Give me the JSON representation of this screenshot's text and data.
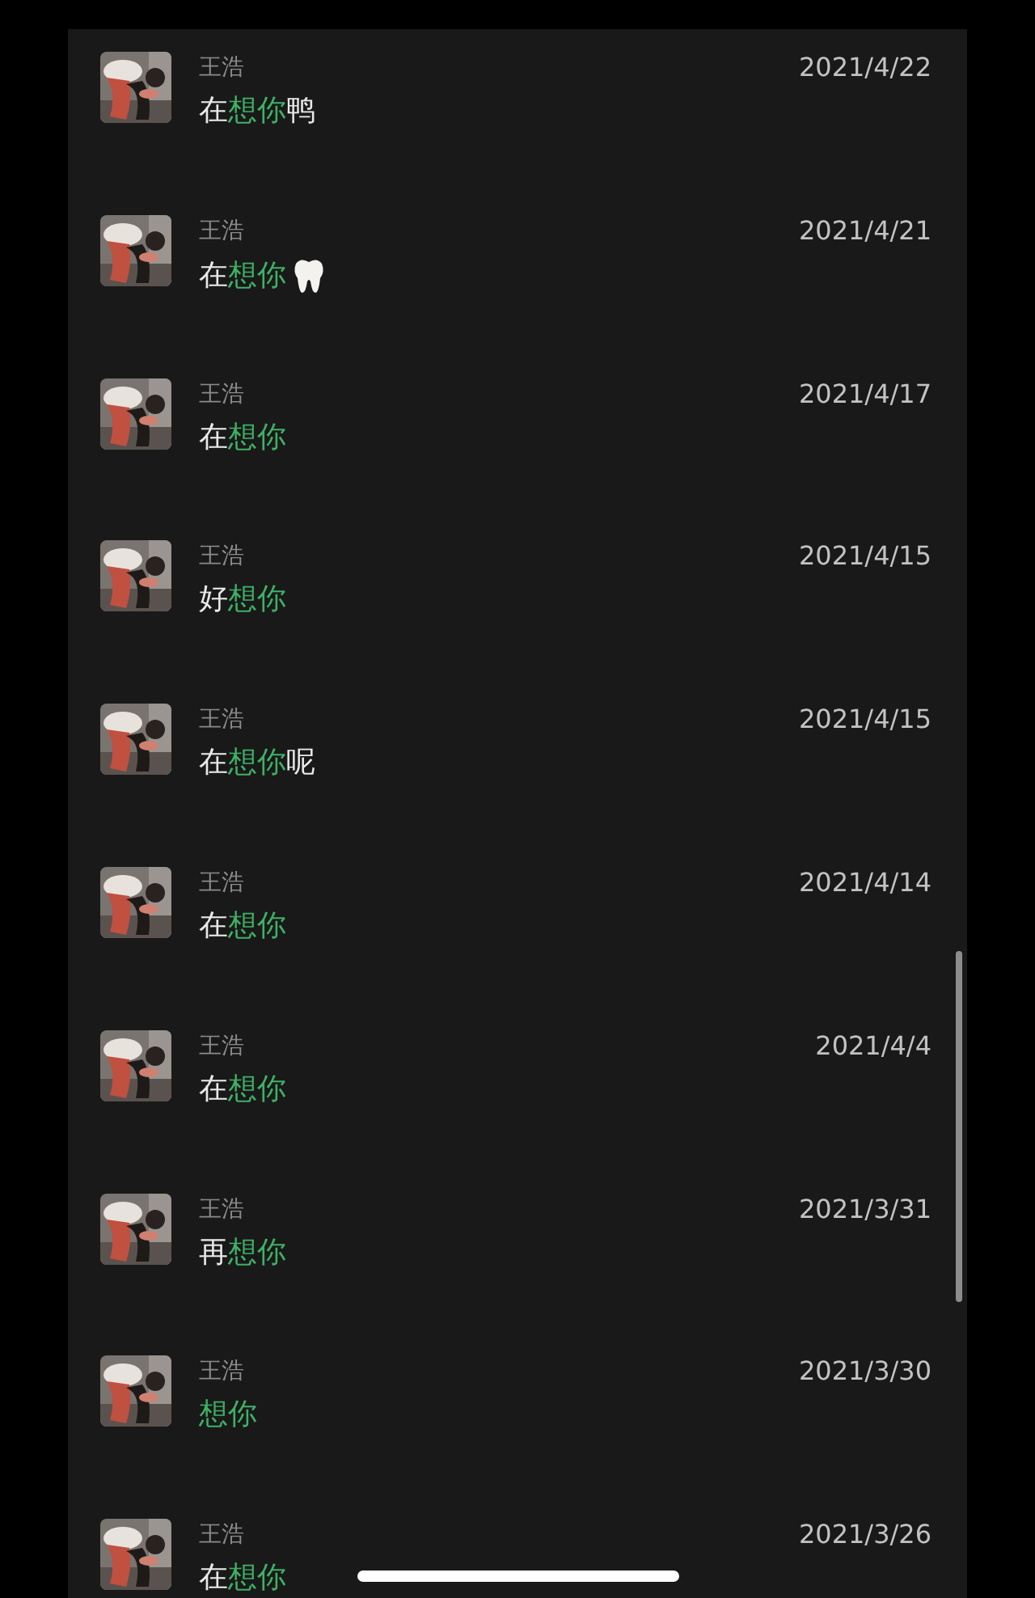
{
  "results": [
    {
      "name": "王浩",
      "date": "2021/4/22",
      "message": [
        {
          "kind": "text",
          "text": "在",
          "highlight": false
        },
        {
          "kind": "text",
          "text": "想你",
          "highlight": true
        },
        {
          "kind": "text",
          "text": "鸭",
          "highlight": false
        }
      ]
    },
    {
      "name": "王浩",
      "date": "2021/4/21",
      "message": [
        {
          "kind": "text",
          "text": "在",
          "highlight": false
        },
        {
          "kind": "text",
          "text": "想你",
          "highlight": true
        },
        {
          "kind": "tooth"
        }
      ]
    },
    {
      "name": "王浩",
      "date": "2021/4/17",
      "message": [
        {
          "kind": "text",
          "text": "在",
          "highlight": false
        },
        {
          "kind": "text",
          "text": "想你",
          "highlight": true
        }
      ]
    },
    {
      "name": "王浩",
      "date": "2021/4/15",
      "message": [
        {
          "kind": "text",
          "text": "好",
          "highlight": false
        },
        {
          "kind": "text",
          "text": "想你",
          "highlight": true
        }
      ]
    },
    {
      "name": "王浩",
      "date": "2021/4/15",
      "message": [
        {
          "kind": "text",
          "text": "在",
          "highlight": false
        },
        {
          "kind": "text",
          "text": "想你",
          "highlight": true
        },
        {
          "kind": "text",
          "text": "呢",
          "highlight": false
        }
      ]
    },
    {
      "name": "王浩",
      "date": "2021/4/14",
      "message": [
        {
          "kind": "text",
          "text": "在",
          "highlight": false
        },
        {
          "kind": "text",
          "text": "想你",
          "highlight": true
        }
      ]
    },
    {
      "name": "王浩",
      "date": "2021/4/4",
      "message": [
        {
          "kind": "text",
          "text": "在",
          "highlight": false
        },
        {
          "kind": "text",
          "text": "想你",
          "highlight": true
        }
      ]
    },
    {
      "name": "王浩",
      "date": "2021/3/31",
      "message": [
        {
          "kind": "text",
          "text": "再",
          "highlight": false
        },
        {
          "kind": "text",
          "text": "想你",
          "highlight": true
        }
      ]
    },
    {
      "name": "王浩",
      "date": "2021/3/30",
      "message": [
        {
          "kind": "text",
          "text": "想你",
          "highlight": true
        }
      ]
    },
    {
      "name": "王浩",
      "date": "2021/3/26",
      "message": [
        {
          "kind": "text",
          "text": "在",
          "highlight": false
        },
        {
          "kind": "text",
          "text": "想你",
          "highlight": true
        }
      ]
    }
  ]
}
